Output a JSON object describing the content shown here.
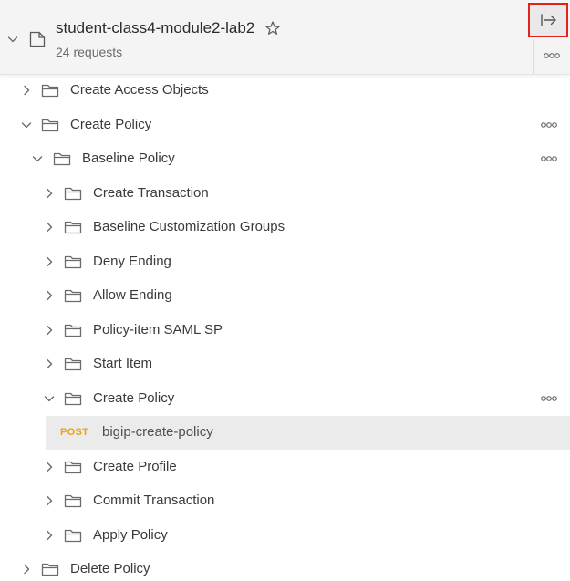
{
  "collection": {
    "title": "student-class4-module2-lab2",
    "request_count": "24 requests"
  },
  "tree": {
    "items": [
      {
        "label": "Create Access Objects"
      },
      {
        "label": "Create Policy"
      },
      {
        "label": "Baseline Policy"
      },
      {
        "label": "Create Transaction"
      },
      {
        "label": "Baseline Customization Groups"
      },
      {
        "label": "Deny Ending"
      },
      {
        "label": "Allow Ending"
      },
      {
        "label": "Policy-item SAML SP"
      },
      {
        "label": "Start Item"
      },
      {
        "label": "Create Policy"
      },
      {
        "label": "Create Profile"
      },
      {
        "label": "Commit Transaction"
      },
      {
        "label": "Apply Policy"
      },
      {
        "label": "Delete Policy"
      }
    ],
    "request": {
      "method": "POST",
      "name": "bigip-create-policy"
    }
  },
  "colors": {
    "highlight_border": "#e2231a",
    "post_method": "#e8a317",
    "selected_row": "#ebebeb"
  },
  "icons": [
    "chevron-right-icon",
    "chevron-down-icon",
    "folder-icon",
    "collection-icon",
    "star-icon",
    "more-options-icon",
    "expand-panel-icon"
  ]
}
